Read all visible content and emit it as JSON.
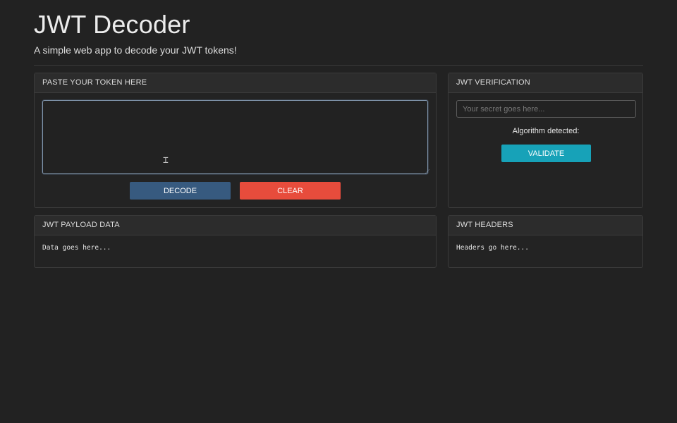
{
  "header": {
    "title": "JWT Decoder",
    "subtitle": "A simple web app to decode your JWT tokens!"
  },
  "token_card": {
    "title": "PASTE YOUR TOKEN HERE",
    "token_value": "",
    "decode_label": "DECODE",
    "clear_label": "CLEAR"
  },
  "verification_card": {
    "title": "JWT VERIFICATION",
    "secret_placeholder": "Your secret goes here...",
    "secret_value": "",
    "algorithm_label": "Algorithm detected:",
    "validate_label": "VALIDATE"
  },
  "payload_card": {
    "title": "JWT PAYLOAD DATA",
    "content": "Data goes here..."
  },
  "headers_card": {
    "title": "JWT HEADERS",
    "content": "Headers go here..."
  },
  "colors": {
    "background": "#222222",
    "decode_button": "#375a7f",
    "clear_button": "#e74c3c",
    "validate_button": "#17a2b8"
  },
  "icons": {
    "text_cursor": "i-beam-cursor-icon"
  }
}
